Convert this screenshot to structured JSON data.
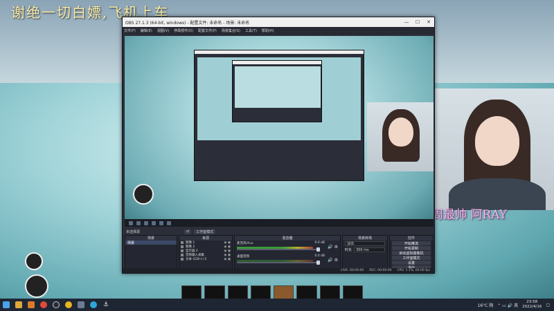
{
  "overlay": {
    "title": "谢绝一切白嫖,飞机上车",
    "name_tag": "上周最帅 阿RAY"
  },
  "obs": {
    "window_title": "OBS 27.1.3 (64-bit, windows) - 配置文件: 未命名 - 场景: 未命名",
    "window_buttons": {
      "minimize": "—",
      "maximize": "☐",
      "close": "✕"
    },
    "menu": [
      "文件(F)",
      "编辑(E)",
      "视图(V)",
      "停靠部件(D)",
      "配置文件(P)",
      "场景集合(S)",
      "工具(T)",
      "帮助(H)"
    ],
    "mode_toggle": [
      "⇄",
      "工作室模式"
    ],
    "docks": {
      "scene_bar_label": "未选择源",
      "scenes": {
        "title": "场景",
        "items": [
          "场景"
        ]
      },
      "sources": {
        "title": "来源",
        "items": [
          {
            "label": "图像 1"
          },
          {
            "label": "图像 2"
          },
          {
            "label": "显示器 2"
          },
          {
            "label": "音频输入采集"
          },
          {
            "label": "文本 (GDI+) 2"
          }
        ]
      },
      "mixer": {
        "title": "混音器",
        "tracks": [
          {
            "name": "麦克风/Aux",
            "db": "0.0 dB"
          },
          {
            "name": "桌面音频",
            "db": "0.0 dB"
          }
        ]
      },
      "transitions": {
        "title": "场景转场",
        "type_label": "淡出",
        "duration_label": "时长",
        "duration_value": "300 ms"
      },
      "controls": {
        "title": "控件",
        "buttons": [
          "开始推流",
          "开始录制",
          "启动虚拟摄像机",
          "工作室模式",
          "设置",
          "退出"
        ]
      }
    },
    "statusbar": {
      "live": "LIVE: 00:00:00",
      "rec": "REC: 00:00:00",
      "cpu": "CPU: 1.1%, 60.00 fps"
    }
  },
  "taskbar": {
    "weather": "16°C 阴",
    "time": "23:58",
    "date": "2022/4/16",
    "icons": [
      "windows-start",
      "explorer",
      "folder",
      "chrome",
      "obs",
      "obs-2",
      "settings",
      "edge",
      "anchor"
    ]
  },
  "colors": {
    "obs_bg": "#2b2e38",
    "overlay_title": "#f6e9a8",
    "overlay_name": "#f0b7ea",
    "taskbar": "#1e2633"
  }
}
